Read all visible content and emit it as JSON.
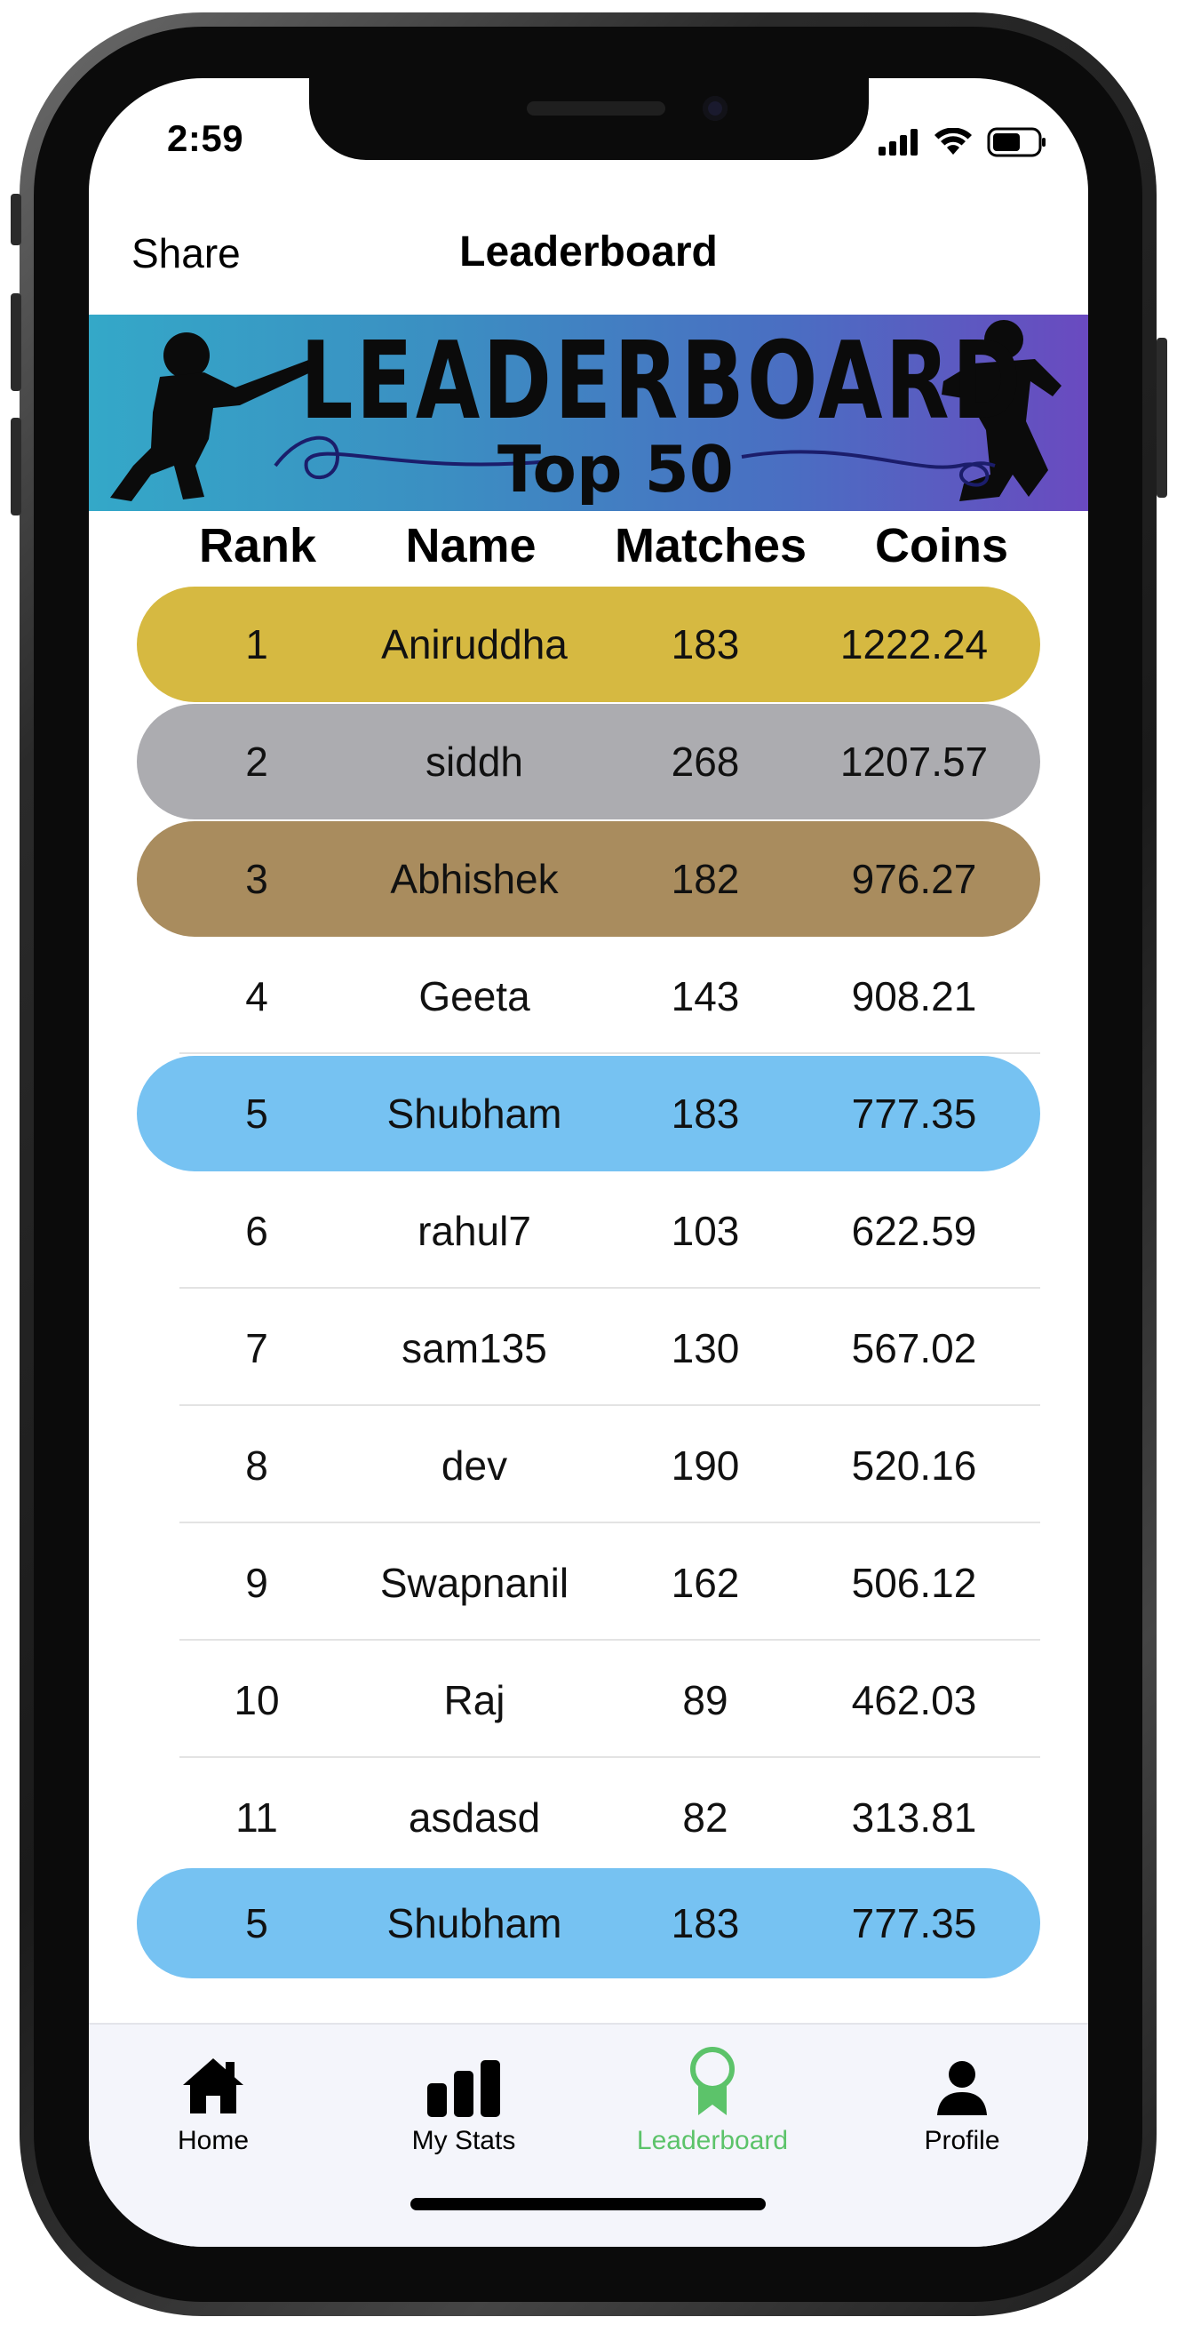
{
  "status_bar": {
    "time": "2:59"
  },
  "nav": {
    "share_label": "Share",
    "title": "Leaderboard"
  },
  "banner": {
    "title": "LEADERBOARD",
    "subtitle": "Top 50"
  },
  "table": {
    "headers": {
      "rank": "Rank",
      "name": "Name",
      "matches": "Matches",
      "coins": "Coins"
    },
    "rows": [
      {
        "rank": "1",
        "name": "Aniruddha",
        "matches": "183",
        "coins": "1222.24"
      },
      {
        "rank": "2",
        "name": "siddh",
        "matches": "268",
        "coins": "1207.57"
      },
      {
        "rank": "3",
        "name": "Abhishek",
        "matches": "182",
        "coins": "976.27"
      },
      {
        "rank": "4",
        "name": "Geeta",
        "matches": "143",
        "coins": "908.21"
      },
      {
        "rank": "5",
        "name": "Shubham",
        "matches": "183",
        "coins": "777.35"
      },
      {
        "rank": "6",
        "name": "rahul7",
        "matches": "103",
        "coins": "622.59"
      },
      {
        "rank": "7",
        "name": "sam135",
        "matches": "130",
        "coins": "567.02"
      },
      {
        "rank": "8",
        "name": "dev",
        "matches": "190",
        "coins": "520.16"
      },
      {
        "rank": "9",
        "name": "Swapnanil",
        "matches": "162",
        "coins": "506.12"
      },
      {
        "rank": "10",
        "name": "Raj",
        "matches": "89",
        "coins": "462.03"
      },
      {
        "rank": "11",
        "name": "asdasd",
        "matches": "82",
        "coins": "313.81"
      }
    ],
    "current_user": {
      "rank": "5",
      "name": "Shubham",
      "matches": "183",
      "coins": "777.35"
    }
  },
  "colors": {
    "gold": "#D6B941",
    "silver": "#ACACB0",
    "bronze": "#A98C5E",
    "highlight": "#76C2F2",
    "active_tab": "#5CC36A"
  },
  "tabs": [
    {
      "label": "Home",
      "icon": "home-icon"
    },
    {
      "label": "My Stats",
      "icon": "bar-chart-icon"
    },
    {
      "label": "Leaderboard",
      "icon": "award-icon",
      "active": true
    },
    {
      "label": "Profile",
      "icon": "person-icon"
    }
  ]
}
